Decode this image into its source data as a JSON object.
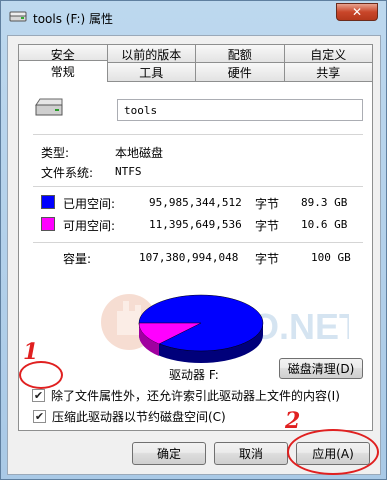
{
  "window": {
    "title": "tools (F:) 属性",
    "close_label": "✕"
  },
  "tabs": {
    "back_row": [
      "安全",
      "以前的版本",
      "配额",
      "自定义"
    ],
    "front_row": [
      "常规",
      "工具",
      "硬件",
      "共享"
    ],
    "active": "常规"
  },
  "general": {
    "drive_name": "tools",
    "type_label": "类型:",
    "type_value": "本地磁盘",
    "fs_label": "文件系统:",
    "fs_value": "NTFS",
    "used": {
      "label": "已用空间:",
      "bytes": "95,985,344,512",
      "unit": "字节",
      "size": "89.3 GB",
      "color": "#0000ff"
    },
    "free": {
      "label": "可用空间:",
      "bytes": "11,395,649,536",
      "unit": "字节",
      "size": "10.6 GB",
      "color": "#ff00ff"
    },
    "capacity": {
      "label": "容量:",
      "bytes": "107,380,994,048",
      "unit": "字节",
      "size": "100 GB"
    },
    "drive_label": "驱动器 F:",
    "cleanup_button": "磁盘清理(D)",
    "compress_checkbox": "压缩此驱动器以节约磁盘空间(C)",
    "index_checkbox": "除了文件属性外，还允许索引此驱动器上文件的内容(I)",
    "compress_checked": true,
    "index_checked": true
  },
  "buttons": {
    "ok": "确定",
    "cancel": "取消",
    "apply": "应用(A)"
  },
  "annotations": {
    "n1": "1",
    "n2": "2"
  },
  "watermark": "YESIO.NET"
}
